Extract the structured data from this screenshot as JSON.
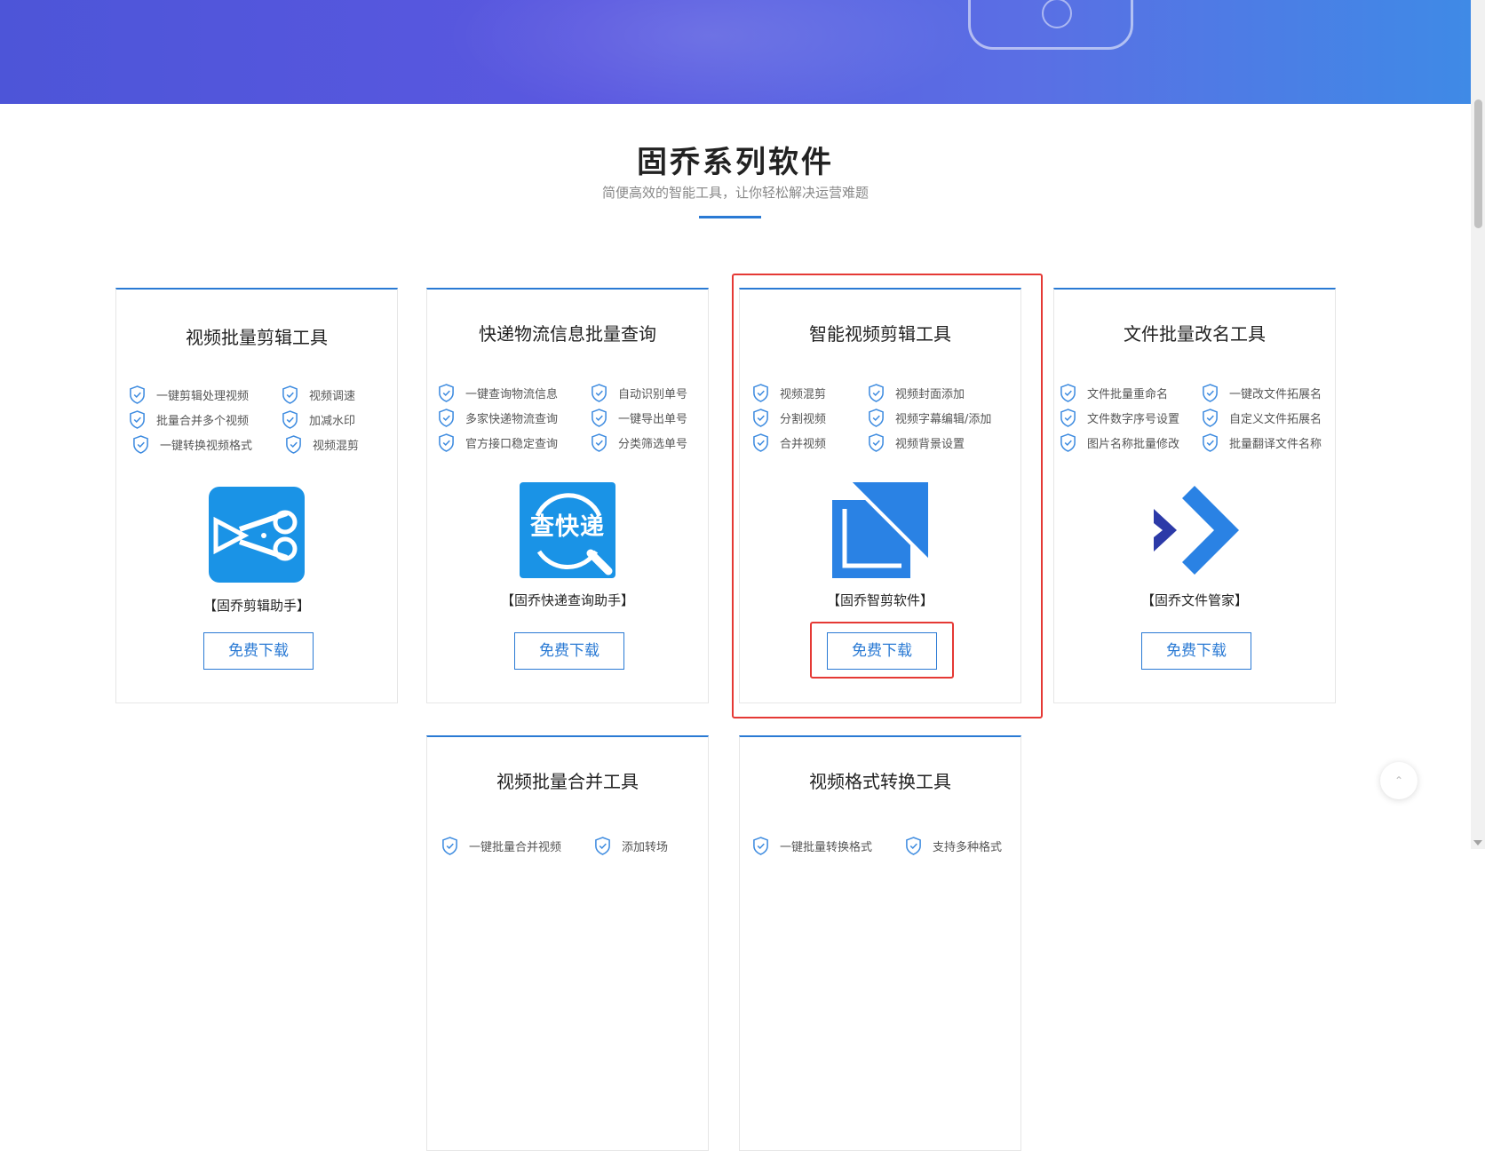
{
  "section": {
    "title": "固乔系列软件",
    "subtitle": "简便高效的智能工具，让你轻松解决运营难题"
  },
  "cards": [
    {
      "title": "视频批量剪辑工具",
      "features": [
        "一键剪辑处理视频",
        "视频调速",
        "批量合并多个视频",
        "加减水印",
        "一键转换视频格式",
        "视频混剪"
      ],
      "product_name": "【固乔剪辑助手】",
      "download_label": "免费下载",
      "icon": "scissors-icon"
    },
    {
      "title": "快递物流信息批量查询",
      "features": [
        "一键查询物流信息",
        "自动识别单号",
        "多家快递物流查询",
        "一键导出单号",
        "官方接口稳定查询",
        "分类筛选单号"
      ],
      "product_name": "【固乔快递查询助手】",
      "download_label": "免费下载",
      "icon": "express-search-icon",
      "icon_text": "查快递"
    },
    {
      "title": "智能视频剪辑工具",
      "features": [
        "视频混剪",
        "视频封面添加",
        "分割视频",
        "视频字幕编辑/添加",
        "合并视频",
        "视频背景设置"
      ],
      "product_name": "【固乔智剪软件】",
      "download_label": "免费下载",
      "icon": "smart-cut-icon"
    },
    {
      "title": "文件批量改名工具",
      "features": [
        "文件批量重命名",
        "一键改文件拓展名",
        "文件数字序号设置",
        "自定义文件拓展名",
        "图片名称批量修改",
        "批量翻译文件名称"
      ],
      "product_name": "【固乔文件管家】",
      "download_label": "免费下载",
      "icon": "file-manager-icon"
    },
    {
      "title": "视频批量合并工具",
      "features": [
        "一键批量合并视频",
        "添加转场"
      ]
    },
    {
      "title": "视频格式转换工具",
      "features": [
        "一键批量转换格式",
        "支持多种格式"
      ]
    }
  ],
  "colors": {
    "accent": "#2a7ad4",
    "highlight": "#e53935",
    "banner_start": "#4d55d8",
    "banner_end": "#3f8ae6"
  }
}
